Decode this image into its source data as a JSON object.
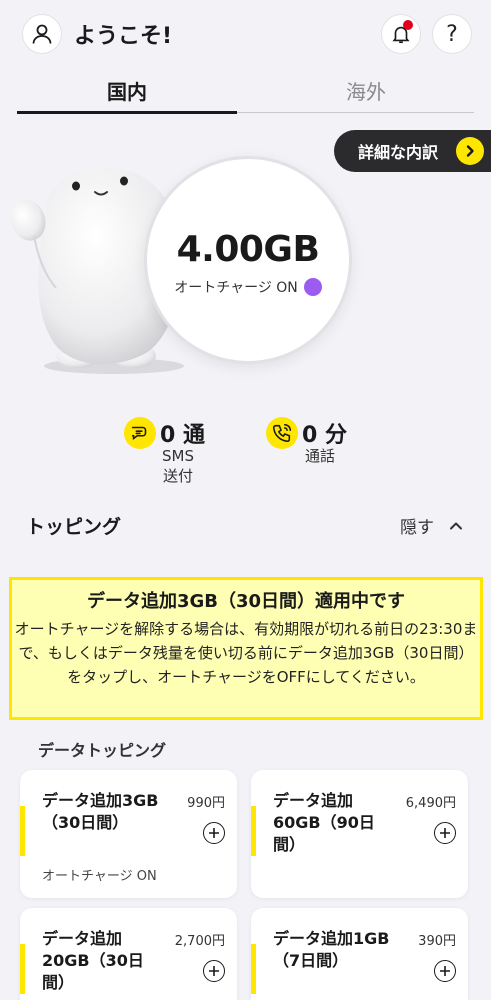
{
  "header": {
    "welcome": "ようこそ!",
    "help_label": "?"
  },
  "tabs": {
    "domestic": "国内",
    "overseas": "海外"
  },
  "breakdown_label": "詳細な内訳",
  "data": {
    "amount": "4.00GB",
    "auto_charge": "オートチャージ ON"
  },
  "stats": {
    "sms_value": "0 通",
    "sms_label": "SMS\n送付",
    "call_value": "0 分",
    "call_label": "通話"
  },
  "topping": {
    "title": "トッピング",
    "hide_label": "隠す",
    "notice_title": "データ追加3GB（30日間）適用中です",
    "notice_body": "オートチャージを解除する場合は、有効期限が切れる前日の23:30まで、もしくはデータ残量を使い切る前にデータ追加3GB（30日間）をタップし、オートチャージをOFFにしてください。",
    "data_section_title": "データトッピング",
    "cards": [
      {
        "name": "データ追加3GB（30日間）",
        "price": "990円",
        "sub": "オートチャージ ON"
      },
      {
        "name": "データ追加60GB（90日間）",
        "price": "6,490円",
        "sub": ""
      },
      {
        "name": "データ追加20GB（30日間）",
        "price": "2,700円",
        "sub": ""
      },
      {
        "name": "データ追加1GB（7日間）",
        "price": "390円",
        "sub": ""
      }
    ]
  },
  "colors": {
    "accent": "#ffe600",
    "dark": "#2b2b2e",
    "status_dot": "#9c5cf2",
    "notification": "#e0001b"
  }
}
